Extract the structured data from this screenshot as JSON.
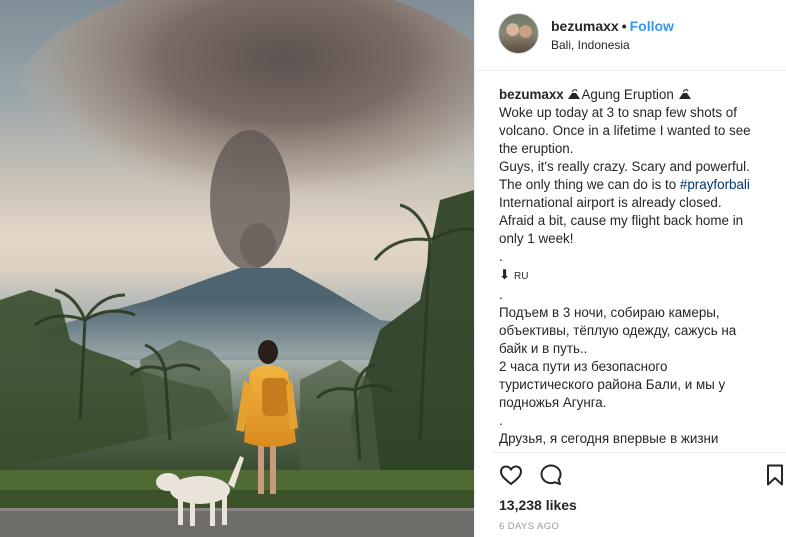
{
  "post": {
    "image_alt": "Woman in a yellow raincoat watching Mount Agung erupting in Bali, with a dog walking by",
    "header": {
      "username": "bezumaxx",
      "separator": "•",
      "follow_label": "Follow",
      "location": "Bali, Indonesia"
    },
    "caption": {
      "username": "bezumaxx",
      "title": "Agung Eruption",
      "lines": [
        "Woke up today at 3 to snap few shots of",
        "volcano. Once in a lifetime I wanted to see",
        "the eruption.",
        "Guys, it's really crazy. Scary and powerful.",
        "The only thing we can do is to",
        "International airport is already closed.",
        "Afraid a bit, cause my flight back home in",
        "only 1 week!",
        ".",
        ".",
        "Подъем в 3 ночи, собираю камеры,",
        "объективы, тёплую одежду, сажусь на",
        "байк и в путь..",
        "2 часа пути из безопасного",
        "туристического района Бали, и мы у",
        "подножья Агунга.",
        ".",
        "Друзья, я сегодня впервые в жизни"
      ],
      "hashtag": "#prayforbali",
      "arrow": "⬇",
      "ru_label": "RU"
    },
    "likes": "13,238 likes",
    "timestamp": "6 DAYS AGO",
    "icons": {
      "like": "heart-icon",
      "comment": "comment-icon",
      "save": "bookmark-icon"
    },
    "colors": {
      "follow": "#3897f0",
      "hashtag": "#003569",
      "timestamp": "#999999"
    }
  }
}
